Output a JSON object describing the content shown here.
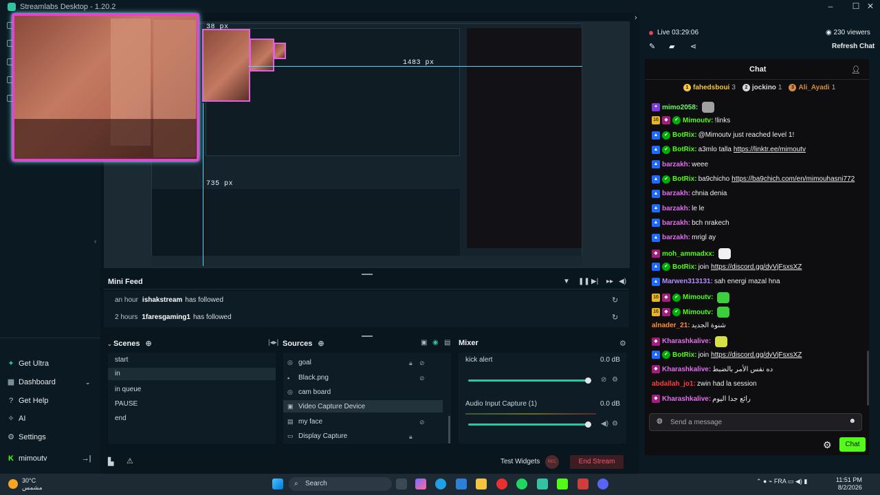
{
  "window": {
    "title": "Streamlabs Desktop - 1.20.2",
    "minimize": "–",
    "maximize": "☐",
    "close": "✕"
  },
  "nav": {
    "items": [
      {
        "label": "Get Ultra",
        "icon": "ultra-icon"
      },
      {
        "label": "Dashboard",
        "icon": "dashboard-icon"
      },
      {
        "label": "Get Help",
        "icon": "help-icon"
      },
      {
        "label": "AI",
        "icon": "ai-icon"
      },
      {
        "label": "Settings",
        "icon": "gear-icon"
      }
    ],
    "user": "mimoutv"
  },
  "preview": {
    "width_label": "38 px",
    "width_label2": "1483 px",
    "height_label": "735 px"
  },
  "minifeed": {
    "title": "Mini Feed",
    "events": [
      {
        "time": "an hour",
        "user": "ishakstream",
        "action": "has followed"
      },
      {
        "time": "2 hours",
        "user": "1faresgaming1",
        "action": "has followed"
      }
    ]
  },
  "scenes": {
    "title": "Scenes",
    "items": [
      "start",
      "in",
      "in queue",
      "PAUSE",
      "end"
    ],
    "selected": 1
  },
  "sources": {
    "title": "Sources",
    "items": [
      "goal",
      "Black.png",
      "cam board",
      "Video Capture Device",
      "my face",
      "Display Capture"
    ],
    "selected": 3
  },
  "mixer": {
    "title": "Mixer",
    "channels": [
      {
        "name": "kick alert",
        "db": "0.0 dB",
        "level": 1.0
      },
      {
        "name": "Audio Input Capture (1)",
        "db": "0.0 dB",
        "level": 1.0
      }
    ]
  },
  "footer": {
    "test_widgets": "Test Widgets",
    "rec": "REC",
    "end_stream": "End Stream"
  },
  "chatpanel": {
    "live": "Live 03:29:06",
    "viewers": "230 viewers",
    "refresh": "Refresh Chat",
    "title": "Chat",
    "leaderboard": [
      {
        "rank": "1",
        "name": "fahedsboui",
        "count": "3",
        "color": "#f5c542"
      },
      {
        "rank": "2",
        "name": "jockino",
        "count": "1",
        "color": "#d9d9d9"
      },
      {
        "rank": "3",
        "name": "Ali_Ayadi",
        "count": "1",
        "color": "#d58b45"
      }
    ],
    "messages": [
      {
        "badges": [
          "mod"
        ],
        "user": "mimo2058",
        "color": "#6cf96c",
        "text": "",
        "link": "",
        "emote": "#a0a0a0"
      },
      {
        "badges": [
          "sub",
          "vip",
          "check"
        ],
        "user": "Mimoutv",
        "color": "#53fc18",
        "text": "!links",
        "link": "",
        "emote": ""
      },
      {
        "badges": [
          "bot",
          "check"
        ],
        "user": "BotRix",
        "color": "#53fc18",
        "text": "@Mimoutv just reached level 1!",
        "link": "",
        "emote": ""
      },
      {
        "badges": [
          "bot",
          "check"
        ],
        "user": "BotRix",
        "color": "#53fc18",
        "text": "a3mlo talla",
        "link": "https://linktr.ee/mimoutv",
        "emote": ""
      },
      {
        "badges": [
          "bot"
        ],
        "user": "barzakh",
        "color": "#e26ef0",
        "text": "weee",
        "link": "",
        "emote": ""
      },
      {
        "badges": [
          "bot",
          "check"
        ],
        "user": "BotRix",
        "color": "#53fc18",
        "text": "ba9chicho",
        "link": "https://ba9chich.com/en/mimouhasni772",
        "emote": ""
      },
      {
        "badges": [
          "bot"
        ],
        "user": "barzakh",
        "color": "#e26ef0",
        "text": "chnia denia",
        "link": "",
        "emote": ""
      },
      {
        "badges": [
          "bot"
        ],
        "user": "barzakh",
        "color": "#e26ef0",
        "text": "le le",
        "link": "",
        "emote": ""
      },
      {
        "badges": [
          "bot"
        ],
        "user": "barzakh",
        "color": "#e26ef0",
        "text": "bch nrakech",
        "link": "",
        "emote": ""
      },
      {
        "badges": [
          "bot"
        ],
        "user": "barzakh",
        "color": "#e26ef0",
        "text": "mrigl ay",
        "link": "",
        "emote": ""
      },
      {
        "badges": [
          "vip"
        ],
        "user": "moh_ammadxx",
        "color": "#53fc18",
        "text": "",
        "link": "",
        "emote": "#f0f0f0"
      },
      {
        "badges": [
          "bot",
          "check"
        ],
        "user": "BotRix",
        "color": "#53fc18",
        "text": "join",
        "link": "https://discord.gg/dyVjFsxsXZ",
        "emote": ""
      },
      {
        "badges": [
          "bot"
        ],
        "user": "Marwen313131",
        "color": "#b38cff",
        "text": "sah energi mazal hna",
        "link": "",
        "emote": ""
      },
      {
        "badges": [
          "sub",
          "vip",
          "check"
        ],
        "user": "Mimoutv",
        "color": "#53fc18",
        "text": "",
        "link": "",
        "emote": "#3ccf3c"
      },
      {
        "badges": [
          "sub",
          "vip",
          "check"
        ],
        "user": "Mimoutv",
        "color": "#53fc18",
        "text": "",
        "link": "",
        "emote": "#3ccf3c"
      },
      {
        "badges": [],
        "user": "alnader_21",
        "color": "#ff8a3d",
        "text": "شنوة الجديد",
        "link": "",
        "emote": ""
      },
      {
        "badges": [
          "vip"
        ],
        "user": "Kharashkalive",
        "color": "#e26ef0",
        "text": "",
        "link": "",
        "emote": "#d8e048"
      },
      {
        "badges": [
          "bot",
          "check"
        ],
        "user": "BotRix",
        "color": "#53fc18",
        "text": "join",
        "link": "https://discord.gg/dyVjFsxsXZ",
        "emote": ""
      },
      {
        "badges": [
          "vip"
        ],
        "user": "Kharashkalive",
        "color": "#e26ef0",
        "text": "ده نفس الأمر بالضبط",
        "link": "",
        "emote": ""
      },
      {
        "badges": [],
        "user": "abdallah_jo1",
        "color": "#ff3b3b",
        "text": "zwin had la session",
        "link": "",
        "emote": ""
      },
      {
        "badges": [
          "vip"
        ],
        "user": "Kharashkalive",
        "color": "#e26ef0",
        "text": "رائع جدا اليوم",
        "link": "",
        "emote": ""
      }
    ],
    "input_placeholder": "Send a message",
    "send": "Chat"
  },
  "taskbar": {
    "temp": "30°C",
    "weather_desc": "مشمس",
    "search": "Search",
    "lang": "FRA",
    "time": "11:51 PM",
    "date": "8/2/2026"
  }
}
